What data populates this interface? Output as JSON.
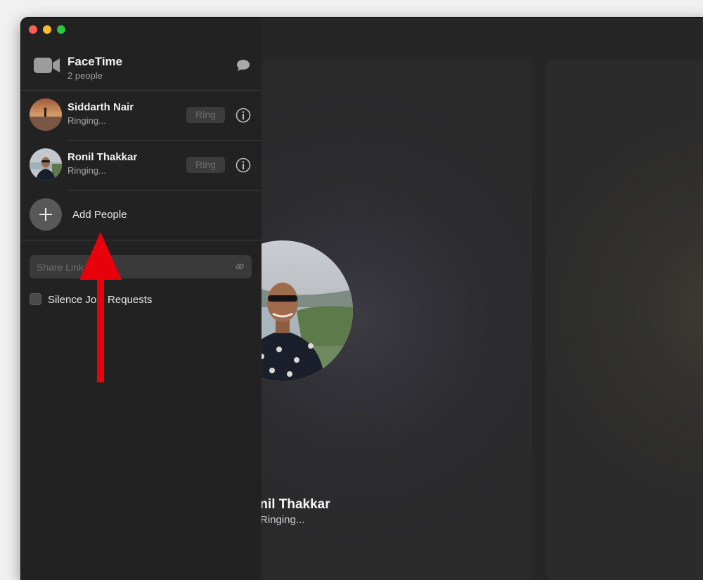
{
  "window": {
    "title": "FaceTime",
    "subtitle": "2 people"
  },
  "participants": [
    {
      "name": "Siddarth Nair",
      "status": "Ringing...",
      "action": "Ring",
      "avatar_icon": "avatar-siddarth"
    },
    {
      "name": "Ronil Thakkar",
      "status": "Ringing...",
      "action": "Ring",
      "avatar_icon": "avatar-ronil"
    }
  ],
  "add_people": {
    "label": "Add People",
    "icon": "plus-icon"
  },
  "share_link": {
    "placeholder": "Share Link",
    "value": "",
    "icon": "link-icon"
  },
  "silence": {
    "label": "Silence Join Requests",
    "checked": false
  },
  "stage": {
    "tile": {
      "name": "Ronil Thakkar",
      "status": "Ringing..."
    }
  },
  "colors": {
    "close": "#fe5f57",
    "minimize": "#febc2e",
    "zoom": "#28c840",
    "annotation_arrow": "#e8000d"
  }
}
